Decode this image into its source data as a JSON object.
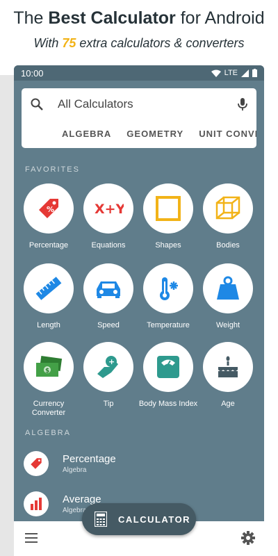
{
  "promo": {
    "title_pre": "The ",
    "title_bold": "Best Calculator",
    "title_post": " for Android",
    "sub_pre": "With ",
    "sub_num": "75",
    "sub_post": " extra calculators & converters"
  },
  "status": {
    "time": "10:00",
    "network": "LTE"
  },
  "search": {
    "text": "All Calculators"
  },
  "tabs": [
    "ALGEBRA",
    "GEOMETRY",
    "UNIT CONVERT"
  ],
  "favorites_label": "FAVORITES",
  "favorites": [
    {
      "label": "Percentage",
      "icon": "percent-tag-icon"
    },
    {
      "label": "Equations",
      "icon": "equation-xy-icon"
    },
    {
      "label": "Shapes",
      "icon": "square-shape-icon"
    },
    {
      "label": "Bodies",
      "icon": "cube-icon"
    },
    {
      "label": "Length",
      "icon": "ruler-icon"
    },
    {
      "label": "Speed",
      "icon": "car-icon"
    },
    {
      "label": "Temperature",
      "icon": "thermometer-icon"
    },
    {
      "label": "Weight",
      "icon": "weight-icon"
    },
    {
      "label": "Currency Converter",
      "icon": "money-icon"
    },
    {
      "label": "Tip",
      "icon": "tip-hand-icon"
    },
    {
      "label": "Body Mass Index",
      "icon": "scale-icon"
    },
    {
      "label": "Age",
      "icon": "cake-icon"
    }
  ],
  "algebra_label": "ALGEBRA",
  "algebra_items": [
    {
      "title": "Percentage",
      "sub": "Algebra",
      "icon": "percent-tag-icon"
    },
    {
      "title": "Average",
      "sub": "Algebra",
      "icon": "bar-chart-icon"
    }
  ],
  "fab_label": "CALCULATOR",
  "colors": {
    "panel": "#607d8b",
    "accent_yellow": "#f2b318",
    "red": "#e53935",
    "blue": "#1e88e5",
    "teal": "#2e9a8e",
    "green": "#2e7d32"
  }
}
